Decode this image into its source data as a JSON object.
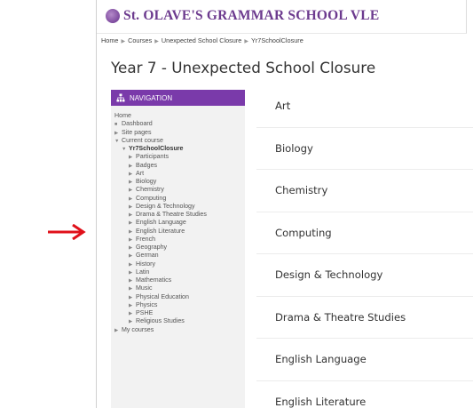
{
  "school_name": "St. OLAVE'S GRAMMAR SCHOOL VLE",
  "breadcrumb": [
    "Home",
    "Courses",
    "Unexpected School Closure",
    "Yr7SchoolClosure"
  ],
  "page_title": "Year 7 - Unexpected School Closure",
  "navigation": {
    "header": "NAVIGATION",
    "items": [
      {
        "label": "Home",
        "caret": ""
      },
      {
        "label": "Dashboard",
        "caret": "■"
      },
      {
        "label": "Site pages",
        "caret": "▶"
      },
      {
        "label": "Current course",
        "caret": "▼"
      },
      {
        "label": "Yr7SchoolClosure",
        "caret": "▼"
      },
      {
        "label": "Participants",
        "caret": "▶"
      },
      {
        "label": "Badges",
        "caret": "▶"
      },
      {
        "label": "Art",
        "caret": "▶"
      },
      {
        "label": "Biology",
        "caret": "▶"
      },
      {
        "label": "Chemistry",
        "caret": "▶"
      },
      {
        "label": "Computing",
        "caret": "▶"
      },
      {
        "label": "Design & Technology",
        "caret": "▶"
      },
      {
        "label": "Drama & Theatre Studies",
        "caret": "▶"
      },
      {
        "label": "English Language",
        "caret": "▶"
      },
      {
        "label": "English Literature",
        "caret": "▶"
      },
      {
        "label": "French",
        "caret": "▶"
      },
      {
        "label": "Geography",
        "caret": "▶"
      },
      {
        "label": "German",
        "caret": "▶"
      },
      {
        "label": "History",
        "caret": "▶"
      },
      {
        "label": "Latin",
        "caret": "▶"
      },
      {
        "label": "Mathematics",
        "caret": "▶"
      },
      {
        "label": "Music",
        "caret": "▶"
      },
      {
        "label": "Physical Education",
        "caret": "▶"
      },
      {
        "label": "Physics",
        "caret": "▶"
      },
      {
        "label": "PSHE",
        "caret": "▶"
      },
      {
        "label": "Religious Studies",
        "caret": "▶"
      },
      {
        "label": "My courses",
        "caret": "▶"
      }
    ]
  },
  "sections": [
    "Art",
    "Biology",
    "Chemistry",
    "Computing",
    "Design & Technology",
    "Drama & Theatre Studies",
    "English Language",
    "English Literature"
  ],
  "colors": {
    "brand": "#6c3a8e",
    "nav_header": "#7a3aaa",
    "arrow": "#e0101a"
  },
  "icons": {
    "arrow": "right-arrow-icon",
    "crest": "school-crest-icon",
    "nav": "sitemap-icon"
  }
}
